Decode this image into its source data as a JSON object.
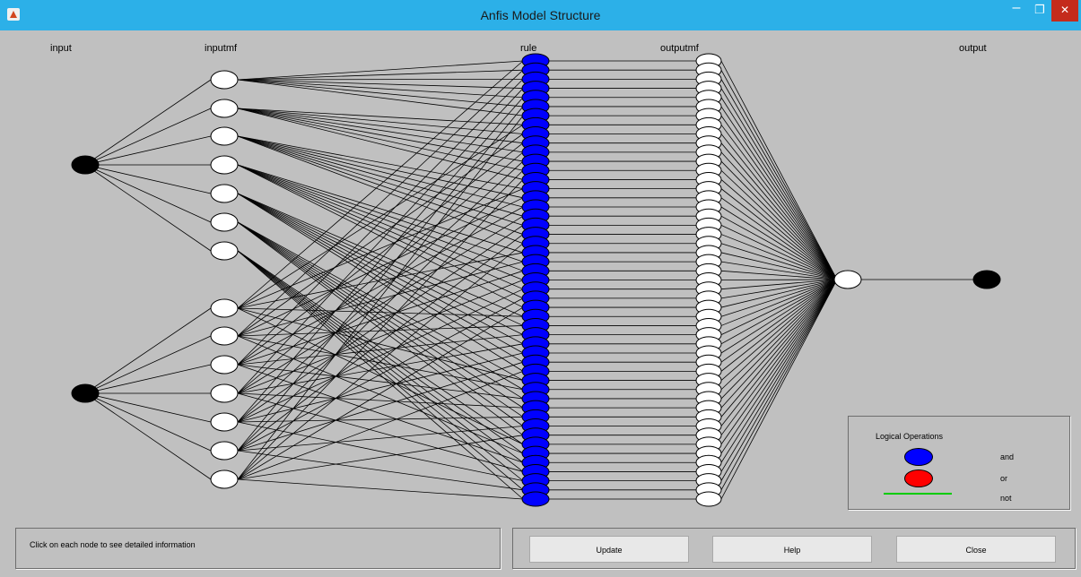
{
  "window": {
    "title": "Anfis Model Structure",
    "min_symbol": "–",
    "max_symbol": "❐",
    "close_symbol": "✕"
  },
  "columns": {
    "input": "input",
    "inputmf": "inputmf",
    "rule": "rule",
    "outputmf": "outputmf",
    "output": "output"
  },
  "network": {
    "inputs": 2,
    "inputmfs_per_input": 7,
    "rules": 49,
    "outputmfs": 49,
    "outputs": 1
  },
  "colors": {
    "and": "#0000ff",
    "or": "#ff0000",
    "not": "#00cc00",
    "node_fill": "#ffffff",
    "io_node": "#000000",
    "background": "#c0c0c0",
    "titlebar": "#2cb0e8"
  },
  "legend": {
    "title": "Logical Operations",
    "and": "and",
    "or": "or",
    "not": "not"
  },
  "status": {
    "text": "Click on each node to see detailed information"
  },
  "buttons": {
    "update": "Update",
    "help": "Help",
    "close": "Close"
  }
}
